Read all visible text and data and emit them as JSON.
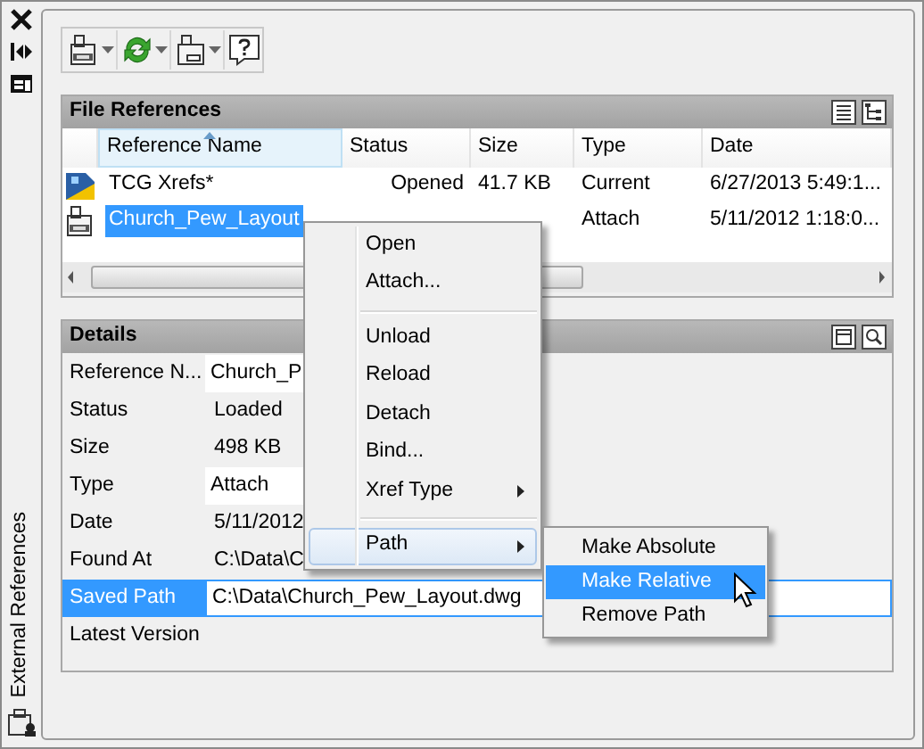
{
  "palette": {
    "title": "External References"
  },
  "toolbar": [
    {
      "kind": "attach",
      "dropdown": true
    },
    {
      "kind": "refresh",
      "dropdown": true
    },
    {
      "kind": "change-path",
      "dropdown": true
    },
    {
      "kind": "help",
      "dropdown": false
    }
  ],
  "file_references": {
    "title": "File References",
    "columns": [
      {
        "sorted": false
      },
      {
        "label": "Reference Name",
        "sorted": true
      },
      {
        "label": "Status",
        "sorted": false
      },
      {
        "label": "Size",
        "sorted": false
      },
      {
        "label": "Type",
        "sorted": false
      },
      {
        "label": "Date",
        "sorted": false
      }
    ],
    "rows": [
      {
        "kind": "drawing-set",
        "name": "TCG Xrefs*",
        "status": "Opened",
        "size": "41.7 KB",
        "type": "Current",
        "date": "6/27/2013 5:49:1...",
        "selected": false
      },
      {
        "kind": "dwg",
        "name": "Church_Pew_Layout",
        "type": "Attach",
        "date": "5/11/2012 1:18:0...",
        "selected": true
      }
    ]
  },
  "details": {
    "title": "Details",
    "rows": [
      {
        "label": "Reference N...",
        "value": "Church_P",
        "editable": true,
        "selected": false
      },
      {
        "label": "Status",
        "value": "Loaded",
        "editable": false,
        "selected": false
      },
      {
        "label": "Size",
        "value": "498 KB",
        "editable": false,
        "selected": false
      },
      {
        "label": "Type",
        "value": "Attach",
        "editable": true,
        "selected": false
      },
      {
        "label": "Date",
        "value": "5/11/2012",
        "editable": false,
        "selected": false
      },
      {
        "label": "Found At",
        "value": "C:\\Data\\C",
        "editable": false,
        "selected": false
      },
      {
        "label": "Saved Path",
        "value": "C:\\Data\\Church_Pew_Layout.dwg",
        "editable": true,
        "selected": true
      },
      {
        "label": "Latest Version",
        "editable": false,
        "selected": false
      }
    ]
  },
  "context_menu": [
    {
      "kind": "item",
      "label": "Open",
      "selected": false
    },
    {
      "kind": "item",
      "label": "Attach...",
      "selected": false
    },
    {
      "kind": "separator"
    },
    {
      "kind": "item",
      "label": "Unload",
      "selected": false
    },
    {
      "kind": "item",
      "label": "Reload",
      "selected": false
    },
    {
      "kind": "item",
      "label": "Detach",
      "selected": false
    },
    {
      "kind": "item",
      "label": "Bind...",
      "selected": false
    },
    {
      "kind": "submenu",
      "label": "Xref Type",
      "selected": false
    },
    {
      "kind": "separator"
    },
    {
      "kind": "submenu",
      "label": "Path",
      "selected": true
    }
  ],
  "submenu": [
    {
      "label": "Make Absolute",
      "selected": false
    },
    {
      "label": "Make Relative",
      "selected": true
    },
    {
      "label": "Remove Path",
      "selected": false
    }
  ]
}
